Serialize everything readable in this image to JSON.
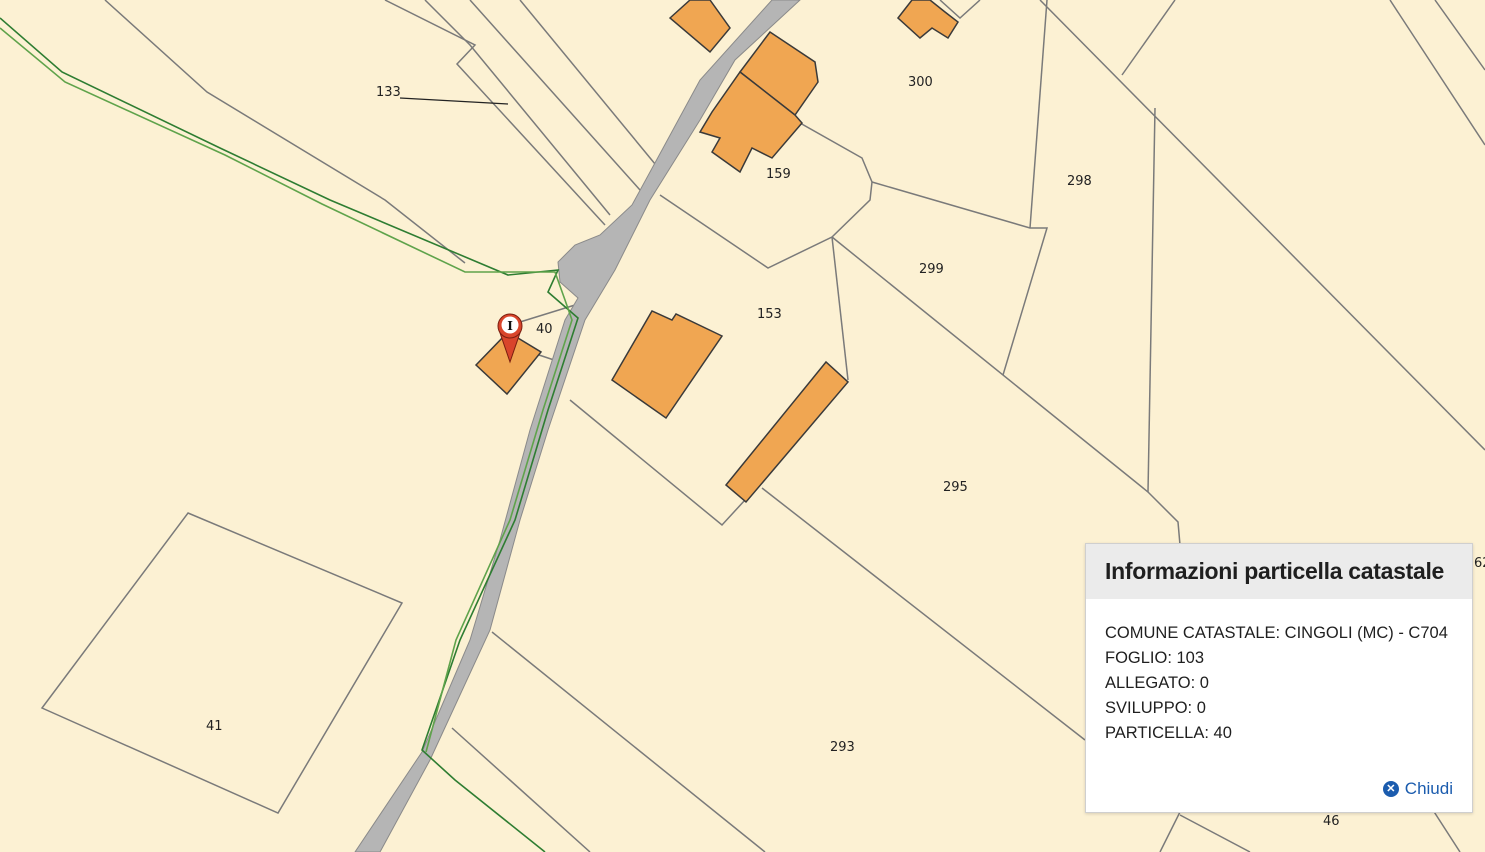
{
  "map": {
    "parcel_labels": [
      "133",
      "300",
      "159",
      "298",
      "299",
      "153",
      "40",
      "295",
      "41",
      "293",
      "46",
      "62"
    ],
    "colors": {
      "background": "#fcf1d3",
      "building": "#f0a652",
      "road": "#b5b5b5",
      "boundary": "#7a7a7a",
      "green_line": "#2e7d32",
      "marker": "#d9452b"
    },
    "marker_icon": "map-pin-info-icon"
  },
  "popup": {
    "title": "Informazioni particella catastale",
    "rows": [
      "COMUNE CATASTALE: CINGOLI (MC) - C704",
      "FOGLIO: 103",
      "ALLEGATO: 0",
      "SVILUPPO: 0",
      "PARTICELLA: 40"
    ],
    "close_label": "Chiudi",
    "close_icon": "close-circle-icon"
  }
}
